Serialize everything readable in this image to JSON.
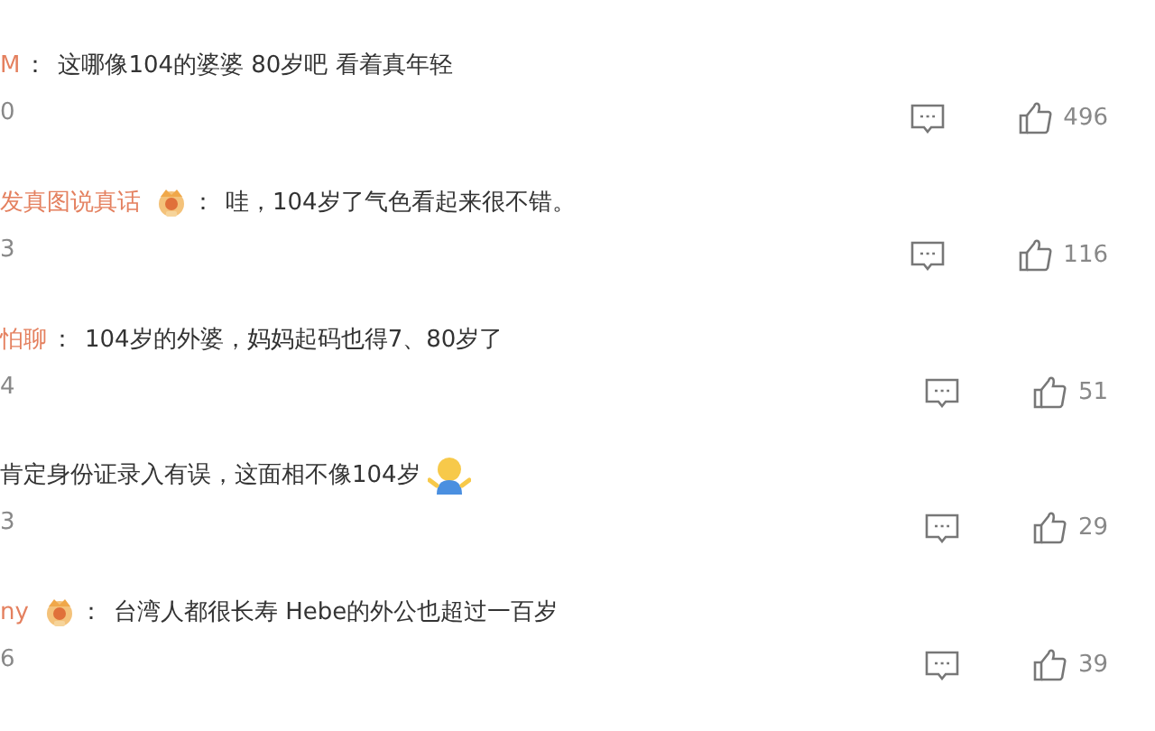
{
  "comments": [
    {
      "name": "M",
      "badge": false,
      "text": "这哪像104的婆婆 80岁吧 看着真年轻",
      "emoji": false,
      "time": "0",
      "likes": "496"
    },
    {
      "name": "发真图说真话",
      "badge": true,
      "text": "哇，104岁了气色看起来很不错。",
      "emoji": false,
      "time": "3",
      "likes": "116"
    },
    {
      "name": "怕聊",
      "badge": false,
      "text": "104岁的外婆，妈妈起码也得7、80岁了",
      "emoji": false,
      "time": "4",
      "likes": "51"
    },
    {
      "text": "肯定身份证录入有误，这面相不像104岁",
      "badge": false,
      "emoji": true,
      "time": "3",
      "likes": "29"
    },
    {
      "name": "ny",
      "badge": true,
      "text": "台湾人都很长寿 Hebe的外公也超过一百岁",
      "emoji": false,
      "time": "6",
      "likes": "39"
    }
  ],
  "separator": "："
}
